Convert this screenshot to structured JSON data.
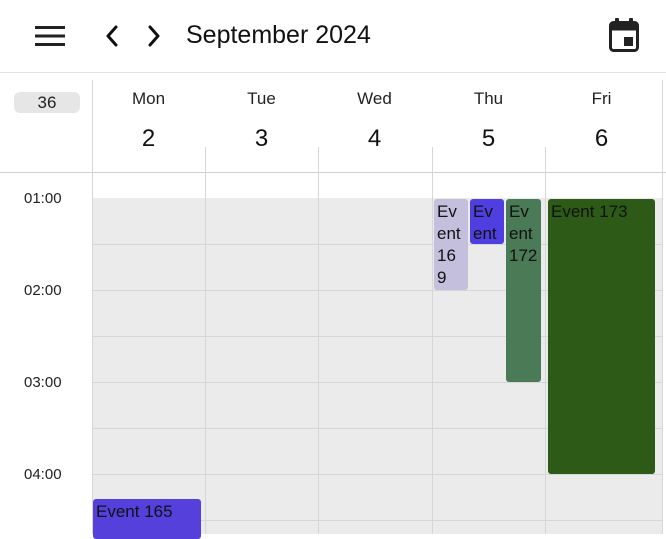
{
  "header": {
    "month_title": "September 2024",
    "menu_icon": "hamburger-menu-icon",
    "prev_icon": "chevron-left-icon",
    "next_icon": "chevron-right-icon",
    "today_icon": "calendar-today-icon"
  },
  "week_number": "36",
  "days": [
    {
      "name": "Mon",
      "number": "2"
    },
    {
      "name": "Tue",
      "number": "3"
    },
    {
      "name": "Wed",
      "number": "4"
    },
    {
      "name": "Thu",
      "number": "5"
    },
    {
      "name": "Fri",
      "number": "6"
    }
  ],
  "times": [
    "01:00",
    "02:00",
    "03:00",
    "04:00"
  ],
  "events": [
    {
      "title": "Event 169",
      "color": "#c3bfdc"
    },
    {
      "title": "Event",
      "color": "#4f3fe0"
    },
    {
      "title": "Event 172",
      "color": "#4a7a56"
    },
    {
      "title": "Event 173",
      "color": "#2d5a17"
    },
    {
      "title": "Event 165",
      "color": "#5540dc"
    }
  ]
}
